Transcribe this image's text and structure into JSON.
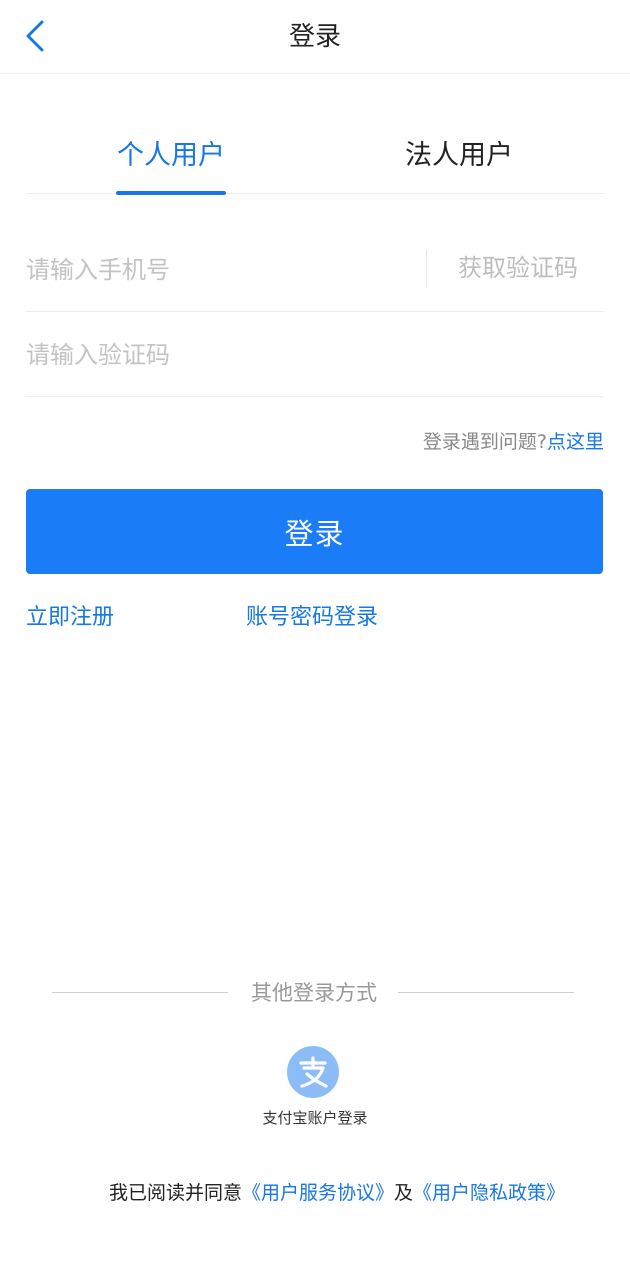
{
  "header": {
    "title": "登录"
  },
  "tabs": [
    {
      "label": "个人用户",
      "active": true
    },
    {
      "label": "法人用户",
      "active": false
    }
  ],
  "form": {
    "phone_placeholder": "请输入手机号",
    "get_code_label": "获取验证码",
    "code_placeholder": "请输入验证码"
  },
  "help": {
    "prefix": "登录遇到问题?",
    "link": "点这里"
  },
  "login_button": "登录",
  "links": {
    "register": "立即注册",
    "password_login": "账号密码登录"
  },
  "other_login": {
    "title": "其他登录方式",
    "alipay_label": "支付宝账户登录"
  },
  "agreement": {
    "prefix": "我已阅读并同意",
    "service": "《用户服务协议》",
    "and": "及",
    "privacy": "《用户隐私政策》"
  },
  "colors": {
    "accent": "#1677e6",
    "button": "#1a7cf6",
    "alipay": "#8cbcf6"
  }
}
